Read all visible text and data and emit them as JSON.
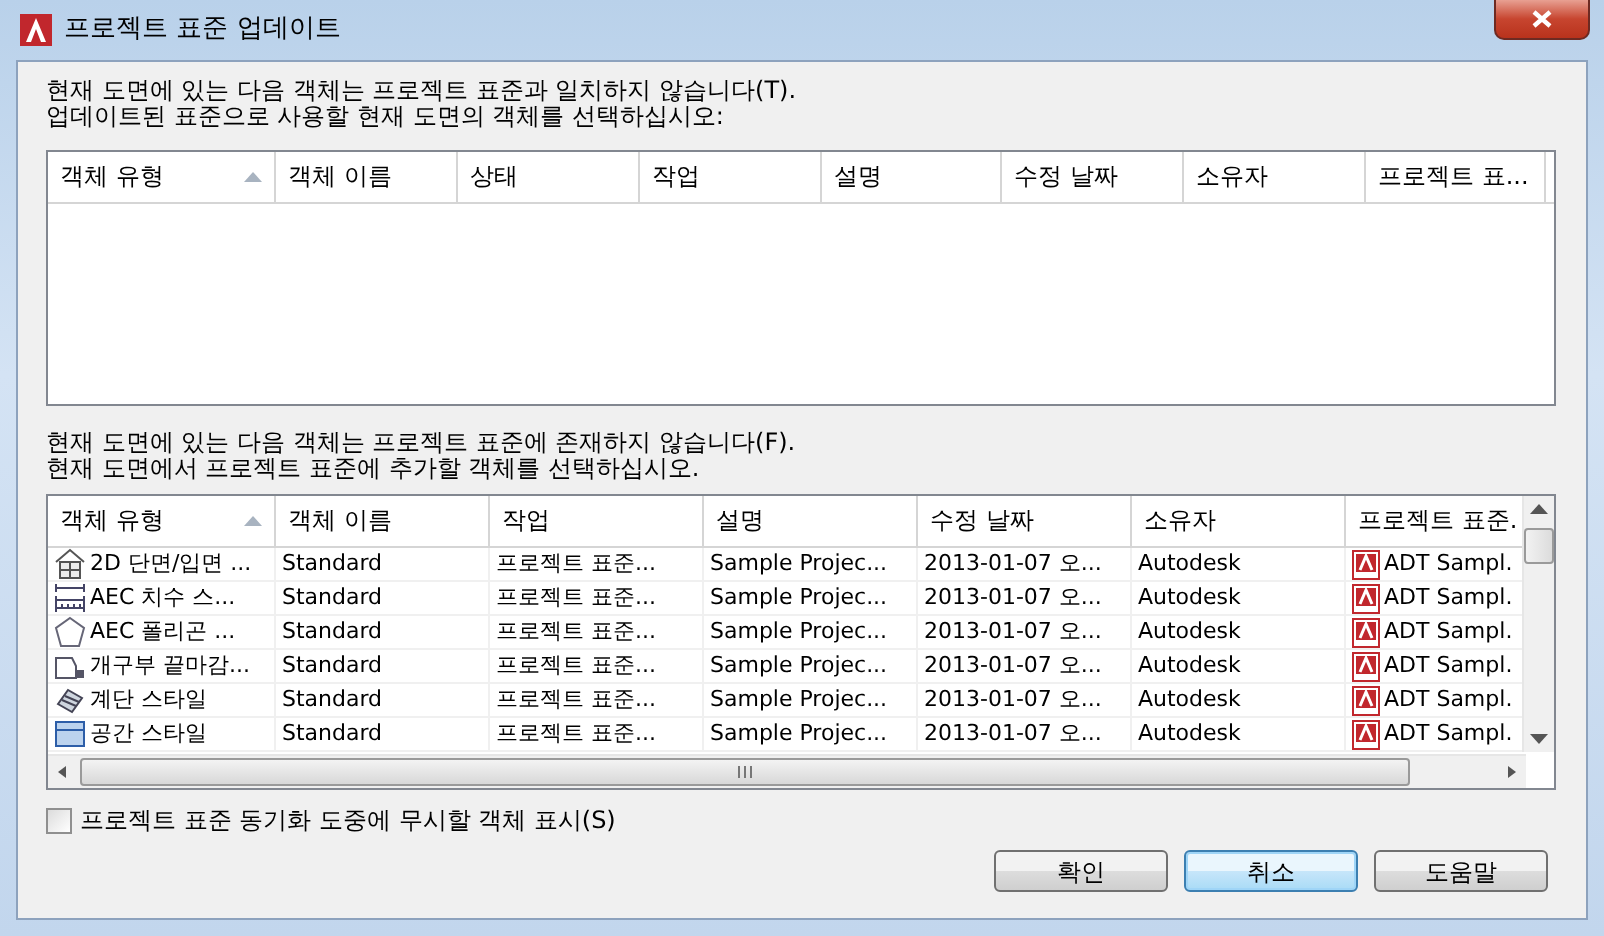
{
  "window": {
    "title": "프로젝트 표준 업데이트"
  },
  "nonmatching": {
    "instruction_1": "현재 도면에 있는 다음 객체는 프로젝트 표준과 일치하지 않습니다(T).",
    "instruction_2": "업데이트된 표준으로 사용할 현재 도면의 객체를 선택하십시오:",
    "columns": [
      {
        "label": "객체 유형",
        "sorted": true
      },
      {
        "label": "객체 이름",
        "sorted": false
      },
      {
        "label": "상태",
        "sorted": false
      },
      {
        "label": "작업",
        "sorted": false
      },
      {
        "label": "설명",
        "sorted": false
      },
      {
        "label": "수정 날짜",
        "sorted": false
      },
      {
        "label": "소유자",
        "sorted": false
      },
      {
        "label": "프로젝트 표...",
        "sorted": false
      }
    ]
  },
  "missing": {
    "instruction_1": "현재 도면에 있는 다음 객체는 프로젝트 표준에 존재하지 않습니다(F).",
    "instruction_2": "현재 도면에서 프로젝트 표준에 추가할 객체를 선택하십시오.",
    "columns": [
      {
        "label": "객체 유형",
        "sorted": true
      },
      {
        "label": "객체 이름",
        "sorted": false
      },
      {
        "label": "작업",
        "sorted": false
      },
      {
        "label": "설명",
        "sorted": false
      },
      {
        "label": "수정 날짜",
        "sorted": false
      },
      {
        "label": "소유자",
        "sorted": false
      },
      {
        "label": "프로젝트 표준.",
        "sorted": false
      }
    ],
    "rows": [
      {
        "kind": "section",
        "cells": [
          "2D 단면/입면 ...",
          "Standard",
          "프로젝트 표준...",
          "Sample Projec...",
          "2013-01-07 오...",
          "Autodesk",
          "ADT Sampl."
        ]
      },
      {
        "kind": "dimension",
        "cells": [
          "AEC 치수 스...",
          "Standard",
          "프로젝트 표준...",
          "Sample Projec...",
          "2013-01-07 오...",
          "Autodesk",
          "ADT Sampl."
        ]
      },
      {
        "kind": "polygon",
        "cells": [
          "AEC 폴리곤 ...",
          "Standard",
          "프로젝트 표준...",
          "Sample Projec...",
          "2013-01-07 오...",
          "Autodesk",
          "ADT Sampl."
        ]
      },
      {
        "kind": "opening",
        "cells": [
          "개구부 끝마감...",
          "Standard",
          "프로젝트 표준...",
          "Sample Projec...",
          "2013-01-07 오...",
          "Autodesk",
          "ADT Sampl."
        ]
      },
      {
        "kind": "stair",
        "cells": [
          "계단 스타일",
          "Standard",
          "프로젝트 표준...",
          "Sample Projec...",
          "2013-01-07 오...",
          "Autodesk",
          "ADT Sampl."
        ]
      },
      {
        "kind": "space",
        "cells": [
          "공간 스타일",
          "Standard",
          "프로젝트 표준...",
          "Sample Projec...",
          "2013-01-07 오...",
          "Autodesk",
          "ADT Sampl."
        ]
      }
    ]
  },
  "ignored_checkbox": {
    "label": "프로젝트 표준 동기화 도중에 무시할 객체 표시(S)",
    "checked": false
  },
  "buttons": [
    {
      "label": "확인",
      "focused": false
    },
    {
      "label": "취소",
      "focused": true
    },
    {
      "label": "도움말",
      "focused": false
    }
  ]
}
